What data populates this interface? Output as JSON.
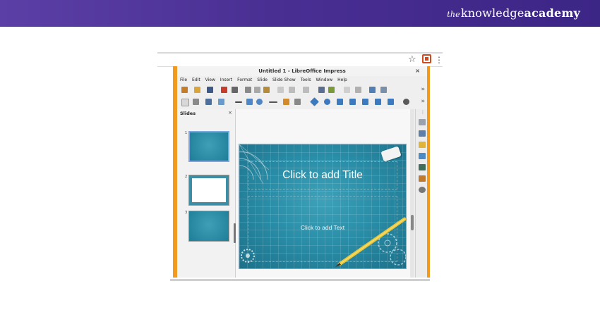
{
  "branding": {
    "the": "the",
    "knowledge": "knowledge",
    "academy": "academy",
    "bar_color": "#4a2f93"
  },
  "browser": {
    "star_icon": "bookmark-star-icon",
    "extension_icon": "libreoffice-extension-icon",
    "menu_icon": "kebab-menu-icon"
  },
  "window": {
    "title": "Untitled 1 - LibreOffice Impress",
    "close": "×"
  },
  "menu": [
    "File",
    "Edit",
    "View",
    "Insert",
    "Format",
    "Slide",
    "Slide Show",
    "Tools",
    "Window",
    "Help"
  ],
  "toolbar": {
    "overflow": "»"
  },
  "slides_pane": {
    "title": "Slides",
    "close": "×",
    "thumbnails": [
      {
        "number": "1",
        "selected": true
      },
      {
        "number": "2",
        "selected": false
      },
      {
        "number": "3",
        "selected": false
      }
    ]
  },
  "slide": {
    "title_placeholder": "Click to add Title",
    "content_placeholder": "Click to add Text",
    "accent_color": "#2a8ea8"
  },
  "colors": {
    "frame_accent": "#f39a1e"
  }
}
